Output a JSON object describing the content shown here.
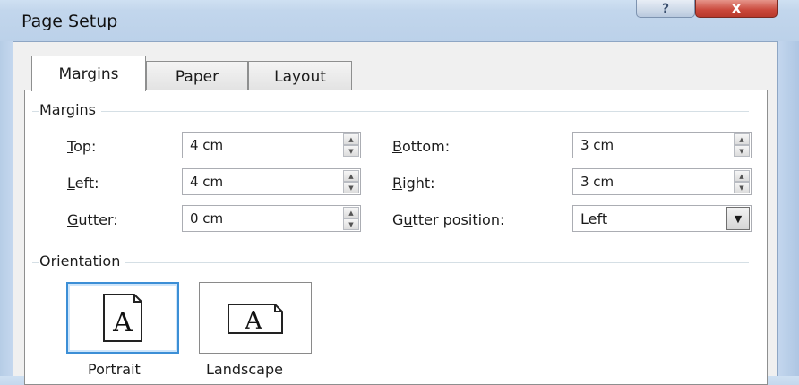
{
  "window": {
    "title": "Page Setup",
    "help_glyph": "?",
    "close_glyph": "X"
  },
  "tabs": [
    {
      "label": "Margins",
      "active": true
    },
    {
      "label": "Paper",
      "active": false
    },
    {
      "label": "Layout",
      "active": false
    }
  ],
  "margins": {
    "group_label": "Margins",
    "top": {
      "label_u": "T",
      "label_rest": "op:",
      "value": "4 cm"
    },
    "left": {
      "label_u": "L",
      "label_rest": "eft:",
      "value": "4 cm"
    },
    "gutter": {
      "label_pre": "",
      "label_u": "G",
      "label_rest": "utter:",
      "value": "0 cm"
    },
    "bottom": {
      "label_u": "B",
      "label_rest": "ottom:",
      "value": "3 cm"
    },
    "right": {
      "label_u": "R",
      "label_rest": "ight:",
      "value": "3 cm"
    },
    "gutter_position": {
      "label_pre": "G",
      "label_u": "u",
      "label_rest": "tter position:",
      "value": "Left"
    }
  },
  "orientation": {
    "group_label": "Orientation",
    "portrait_label": "Portrait",
    "landscape_label": "Landscape",
    "selected": "Portrait",
    "icon_glyph": "A"
  },
  "icons": {
    "up_arrow": "▲",
    "down_arrow": "▼"
  }
}
